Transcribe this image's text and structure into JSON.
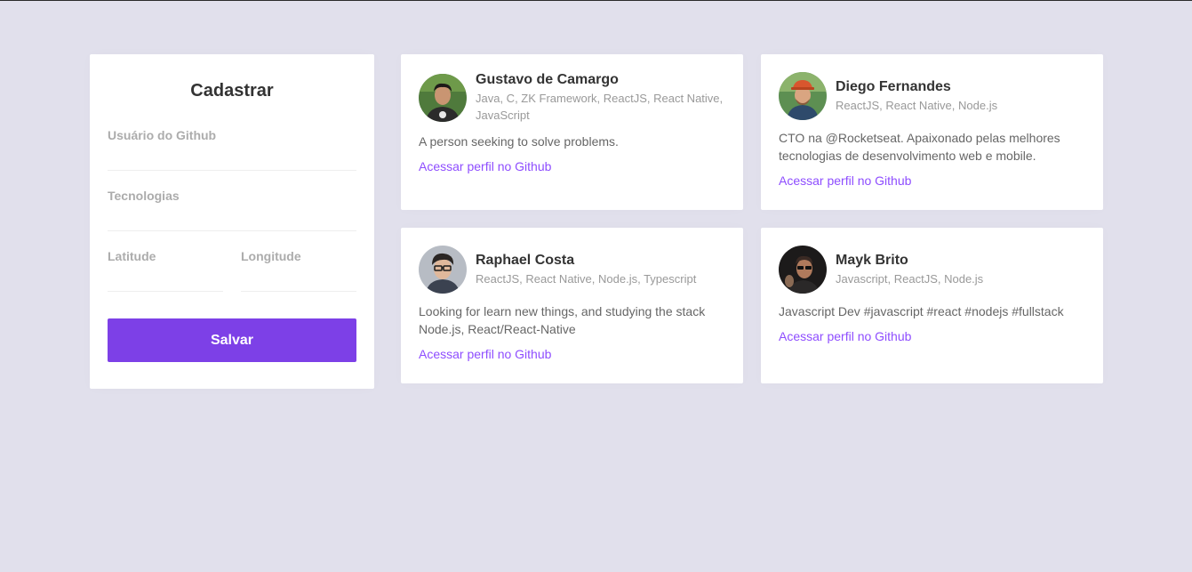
{
  "sidebar": {
    "title": "Cadastrar",
    "fields": {
      "github_username": {
        "label": "Usuário do Github",
        "value": ""
      },
      "techs": {
        "label": "Tecnologias",
        "value": ""
      },
      "latitude": {
        "label": "Latitude",
        "value": ""
      },
      "longitude": {
        "label": "Longitude",
        "value": ""
      }
    },
    "save_label": "Salvar"
  },
  "colors": {
    "background": "#e1e0ec",
    "accent": "#7d40e7",
    "link": "#8e4dff"
  },
  "devs": [
    {
      "name": "Gustavo de Camargo",
      "techs": "Java, C, ZK Framework, ReactJS, React Native, JavaScript",
      "bio": "A person seeking to solve problems.",
      "link_label": "Acessar perfil no Github"
    },
    {
      "name": "Diego Fernandes",
      "techs": "ReactJS, React Native, Node.js",
      "bio": "CTO na @Rocketseat. Apaixonado pelas melhores tecnologias de desenvolvimento web e mobile.",
      "link_label": "Acessar perfil no Github"
    },
    {
      "name": "Raphael Costa",
      "techs": "ReactJS, React Native, Node.js, Typescript",
      "bio": "Looking for learn new things, and studying the stack Node.js, React/React-Native",
      "link_label": "Acessar perfil no Github"
    },
    {
      "name": "Mayk Brito",
      "techs": "Javascript, ReactJS, Node.js",
      "bio": "Javascript Dev #javascript #react #nodejs #fullstack",
      "link_label": "Acessar perfil no Github"
    }
  ]
}
